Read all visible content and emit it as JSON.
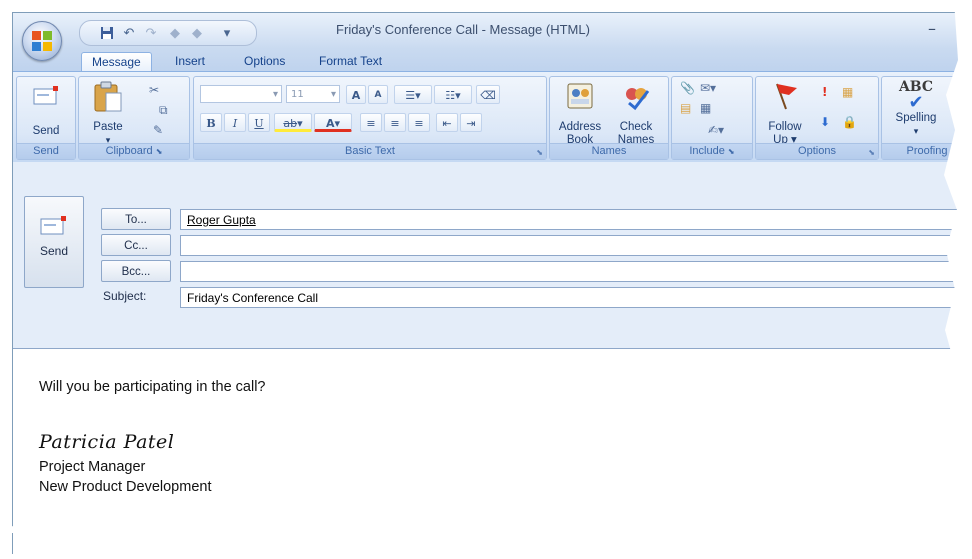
{
  "window": {
    "title": "Friday's Conference Call - Message (HTML)",
    "minimize": "–"
  },
  "tabs": [
    {
      "label": "Message"
    },
    {
      "label": "Insert"
    },
    {
      "label": "Options"
    },
    {
      "label": "Format Text"
    }
  ],
  "ribbon": {
    "send": {
      "button": "Send",
      "group": "Send"
    },
    "clipboard": {
      "paste": "Paste",
      "group": "Clipboard"
    },
    "basic_text": {
      "font_size": "11",
      "group": "Basic Text",
      "bold": "B",
      "italic": "I",
      "underline": "U",
      "grow": "A",
      "shrink": "A",
      "highlight": "ab",
      "color": "A"
    },
    "names": {
      "address_book": "Address Book",
      "address_line1": "Address",
      "address_line2": "Book",
      "check_line1": "Check",
      "check_line2": "Names",
      "group": "Names"
    },
    "include": {
      "group": "Include"
    },
    "options": {
      "follow_line1": "Follow",
      "follow_line2": "Up ▾",
      "group": "Options"
    },
    "proofing": {
      "abc": "ABC",
      "spelling": "Spelling",
      "group": "Proofing"
    }
  },
  "compose": {
    "send": "Send",
    "to_button": "To...",
    "cc_button": "Cc...",
    "bcc_button": "Bcc...",
    "subject_label": "Subject:",
    "to_value": "Roger Gupta",
    "cc_value": "",
    "bcc_value": "",
    "subject_value": "Friday's Conference Call"
  },
  "message": {
    "line1": "Will you be participating in the call?",
    "signature_name": "Patricia Patel",
    "signature_title": "Project Manager",
    "signature_dept": "New Product Development"
  },
  "colors": {
    "ribbon_bg": "#d6e4f7",
    "tab_text": "#15428b",
    "follow_up_flag": "#e03020",
    "orb_red": "#e8541f"
  }
}
